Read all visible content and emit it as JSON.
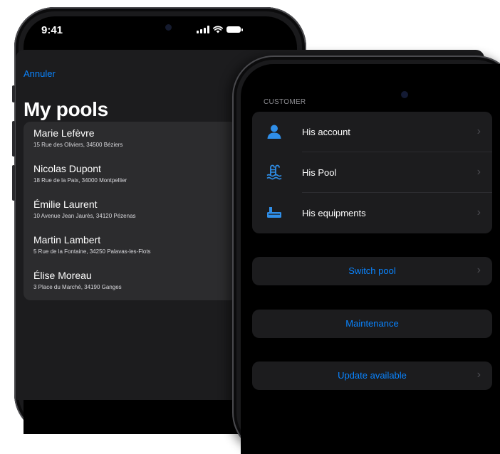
{
  "back_phone": {
    "status_time": "9:41",
    "cancel_label": "Annuler",
    "title": "My pools",
    "pools": [
      {
        "name": "Marie Lefèvre",
        "address": "15 Rue des Oliviers, 34500 Béziers"
      },
      {
        "name": "Nicolas Dupont",
        "address": "18 Rue de la Paix, 34000 Montpellier"
      },
      {
        "name": "Émilie Laurent",
        "address": "10 Avenue Jean Jaurès, 34120 Pézenas"
      },
      {
        "name": "Martin Lambert",
        "address": "5 Rue de la Fontaine, 34250 Palavas-les-Flots"
      },
      {
        "name": "Élise Moreau",
        "address": "3 Place du Marché, 34190 Ganges"
      }
    ]
  },
  "front_phone": {
    "section_header": "CUSTOMER",
    "menu": [
      {
        "label": "His account",
        "icon": "person-icon"
      },
      {
        "label": "His Pool",
        "icon": "pool-icon"
      },
      {
        "label": "His equipments",
        "icon": "pump-icon"
      }
    ],
    "actions": {
      "switch_pool": "Switch pool",
      "maintenance": "Maintenance",
      "update": "Update available"
    },
    "chevron": "›"
  },
  "colors": {
    "accent": "#0a84ff",
    "icon_blue": "#2f8ee8",
    "card_bg": "#1c1c1e",
    "list_bg": "#2c2c2e"
  }
}
